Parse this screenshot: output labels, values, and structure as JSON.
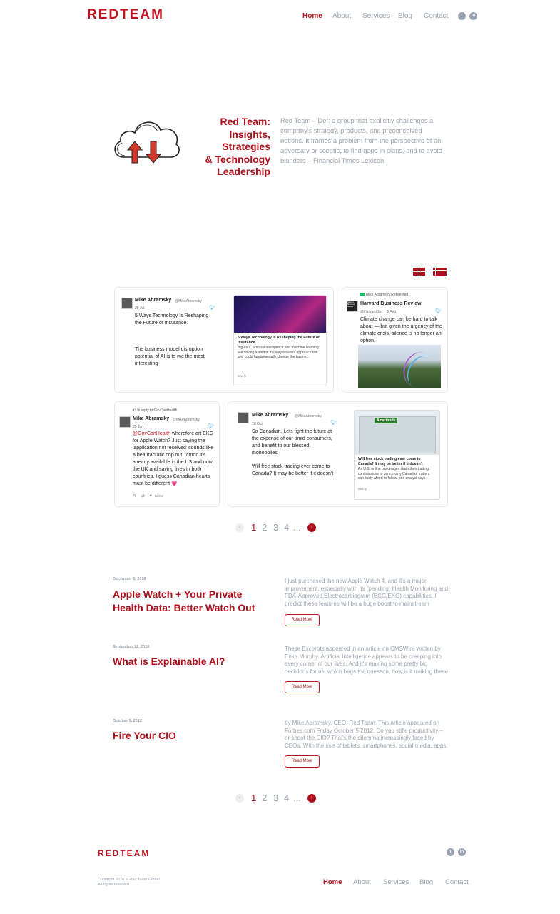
{
  "header": {
    "logo": "REDTEAM",
    "nav": [
      {
        "label": "Home",
        "active": true
      },
      {
        "label": "About"
      },
      {
        "label": "Services"
      },
      {
        "label": "Blog"
      },
      {
        "label": "Contact"
      }
    ],
    "social": [
      "twitter-icon",
      "linkedin-icon"
    ]
  },
  "hero": {
    "title_lines": [
      "Red Team:",
      "Insights, Strategies",
      "& Technology",
      "Leadership"
    ],
    "text": "Red Team – Def: a group that explicitly challenges a company's strategy, products, and preconceived notions. It frames a problem from the perspective of an adversary or sceptic, to find gaps in plans, and to avoid blunders – Financial Times Lexicon."
  },
  "tweets": [
    {
      "name": "Mike Abramsky",
      "handle": "@MikeAbramsky",
      "date": "29 Jul",
      "text1": "5 Ways Technology Is Reshaping the Future of Insurance.",
      "text2": "The business model disruption potential of AI is to me the most interesting",
      "card": {
        "title": "5 Ways Technology Is Reshaping the Future of Insurance",
        "desc": "Big data, artificial intelligence and machine learning are driving a shift in the way insurers approach risk and could fundamentally change the busine...",
        "url": "tww.ly"
      }
    },
    {
      "retweet": "Mike Abramsky Retweeted",
      "name": "Harvard Business Review",
      "handle": "@HarvardBiz",
      "date": "3 Feb",
      "avatar_text": "Harvard Business Review",
      "text": "Climate change can be hard to talk about — but given the urgency of the climate crisis, silence is no longer an option."
    },
    {
      "reply": "In reply to GovCanHealth",
      "name": "Mike Abramsky",
      "handle": "@MikeAbramsky",
      "date": "25 Jun",
      "mention": "@GovCanHealth",
      "text": " wherefore art EKG for Apple Watch? Just saying the 'application not received' sounds like a beauracratic cop out...cmon it's already available in the US and now the UK and saving lives in both countries. I guess Canadian hearts must be different",
      "emoji": "💗",
      "via": "Twitter"
    },
    {
      "name": "Mike Abramsky",
      "handle": "@MikeAbramsky",
      "date": "10 Oct",
      "text1": "So Canadian. Lets fight the future at the expense of our timid consumers, and benefit to our blessed monopolies.",
      "text2": "Will free stock trading ever come to Canada? It may be better if it doesn't",
      "card": {
        "sign": "Ameritrade",
        "title": "Will free stock trading ever come to Canada? It may be better if it doesn't",
        "desc": "As U.S. online brokerages slash their trading commissions to zero, many Canadian traders can likely afford to follow, one analyst says",
        "url": "tww.ly"
      }
    }
  ],
  "pager": {
    "prev": "‹",
    "pages": [
      "1",
      "2",
      "3",
      "4"
    ],
    "ellipsis": "...",
    "next": "›"
  },
  "posts": [
    {
      "date": "December 5, 2018",
      "title": "Apple Watch + Your Private Health Data: Better Watch Out",
      "excerpt": "I just purchased the new Apple Watch 4, and it's a major improvement, especially with its (pending) Health Monitoring and FDA-Approved Electrocardiogram (ECG/EKG) capabilities. I predict these features will be a huge boost to mainstream consumer",
      "button": "Read More"
    },
    {
      "date": "September 12, 2018",
      "title": "What is Explainable AI?",
      "excerpt": "These Excerpts appeared in an article on CMSWire written by Erika Morphy. Artificial intelligence appears to be creeping into every corner of our lives. And it's making some pretty big decisions for us, which begs the question, how is it making these",
      "button": "Read More"
    },
    {
      "date": "October 5, 2012",
      "title": "Fire Your CIO",
      "excerpt": "by Mike Abramsky, CEO, Red Team. This article appeared on Forbes.com Friday October 5 2012. Do you stifle productivity – or shoot the CIO? That's the dilemma increasingly faced by CEOs. With the rise of tablets, smartphones, social media, apps and",
      "button": "Read More"
    }
  ],
  "footer": {
    "logo": "REDTEAM",
    "copyright": "Copyright 2020 © Red Team Global",
    "rights": "All rights reserved",
    "nav": [
      {
        "label": "Home",
        "active": true
      },
      {
        "label": "About"
      },
      {
        "label": "Services"
      },
      {
        "label": "Blog"
      },
      {
        "label": "Contact"
      }
    ]
  },
  "colors": {
    "brand": "#c0121f",
    "muted": "#9aa3ad",
    "twitter": "#1da1f2"
  }
}
